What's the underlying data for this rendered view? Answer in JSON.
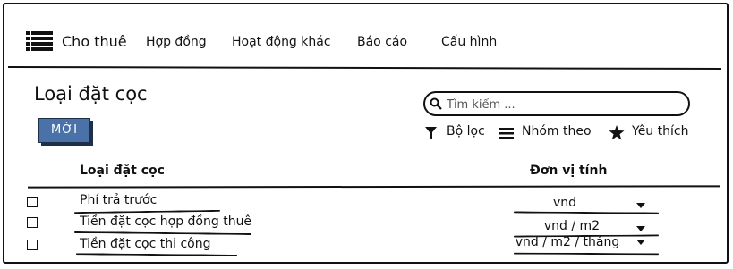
{
  "navbar": {
    "brand": "Cho thuê",
    "items": [
      "Hợp đồng",
      "Hoạt động khác",
      "Báo cáo",
      "Cấu hình"
    ]
  },
  "page": {
    "title": "Loại đặt cọc",
    "new_button": "MỚI"
  },
  "search": {
    "placeholder": "Tìm kiếm ..."
  },
  "filters": {
    "filter_label": "Bộ lọc",
    "group_label": "Nhóm theo",
    "favorite_label": "Yêu thích"
  },
  "table": {
    "headers": [
      "Loại đặt cọc",
      "Đơn vị tính"
    ],
    "rows": [
      {
        "name": "Phí trả trước",
        "unit": "vnd"
      },
      {
        "name": "Tiền đặt cọc hợp đồng thuê",
        "unit": "vnd / m2"
      },
      {
        "name": "Tiền đặt cọc thi công",
        "unit": "vnd / m2 / tháng"
      }
    ]
  }
}
